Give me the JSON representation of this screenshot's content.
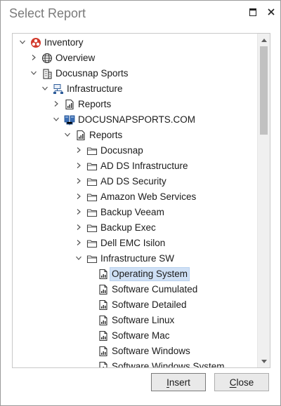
{
  "window": {
    "title": "Select Report",
    "maximize_icon": "maximize-icon",
    "close_icon": "close-icon"
  },
  "tree": {
    "rows": [
      {
        "label": "Inventory",
        "level": 0,
        "expanded": true,
        "icon": "inventory-icon"
      },
      {
        "label": "Overview",
        "level": 1,
        "expanded": false,
        "icon": "globe-icon"
      },
      {
        "label": "Docusnap Sports",
        "level": 1,
        "expanded": true,
        "icon": "building-icon"
      },
      {
        "label": "Infrastructure",
        "level": 2,
        "expanded": true,
        "icon": "network-icon"
      },
      {
        "label": "Reports",
        "level": 3,
        "expanded": false,
        "icon": "report-icon"
      },
      {
        "label": "DOCUSNAPSPORTS.COM",
        "level": 3,
        "expanded": true,
        "icon": "domain-icon"
      },
      {
        "label": "Reports",
        "level": 4,
        "expanded": true,
        "icon": "report-icon"
      },
      {
        "label": "Docusnap",
        "level": 5,
        "expanded": false,
        "icon": "folder-icon"
      },
      {
        "label": "AD DS Infrastructure",
        "level": 5,
        "expanded": false,
        "icon": "folder-icon"
      },
      {
        "label": "AD DS Security",
        "level": 5,
        "expanded": false,
        "icon": "folder-icon"
      },
      {
        "label": "Amazon Web Services",
        "level": 5,
        "expanded": false,
        "icon": "folder-icon"
      },
      {
        "label": "Backup Veeam",
        "level": 5,
        "expanded": false,
        "icon": "folder-icon"
      },
      {
        "label": "Backup Exec",
        "level": 5,
        "expanded": false,
        "icon": "folder-icon"
      },
      {
        "label": "Dell EMC Isilon",
        "level": 5,
        "expanded": false,
        "icon": "folder-icon"
      },
      {
        "label": "Infrastructure SW",
        "level": 5,
        "expanded": true,
        "icon": "folder-icon"
      },
      {
        "label": "Operating System",
        "level": 6,
        "leaf": true,
        "selected": true,
        "icon": "report-file-icon"
      },
      {
        "label": "Software Cumulated",
        "level": 6,
        "leaf": true,
        "icon": "report-file-icon"
      },
      {
        "label": "Software Detailed",
        "level": 6,
        "leaf": true,
        "icon": "report-file-icon"
      },
      {
        "label": "Software Linux",
        "level": 6,
        "leaf": true,
        "icon": "report-file-icon"
      },
      {
        "label": "Software Mac",
        "level": 6,
        "leaf": true,
        "icon": "report-file-icon"
      },
      {
        "label": "Software Windows",
        "level": 6,
        "leaf": true,
        "icon": "report-file-icon"
      },
      {
        "label": "Software Windows System",
        "level": 6,
        "leaf": true,
        "icon": "report-file-icon"
      }
    ]
  },
  "buttons": {
    "insert": {
      "prefix": "",
      "accel": "I",
      "rest": "nsert"
    },
    "close": {
      "prefix": "",
      "accel": "C",
      "rest": "lose"
    }
  },
  "colors": {
    "selection": "#cfe0f5",
    "inventory_red": "#d23a2c",
    "folder_stroke": "#444444"
  }
}
